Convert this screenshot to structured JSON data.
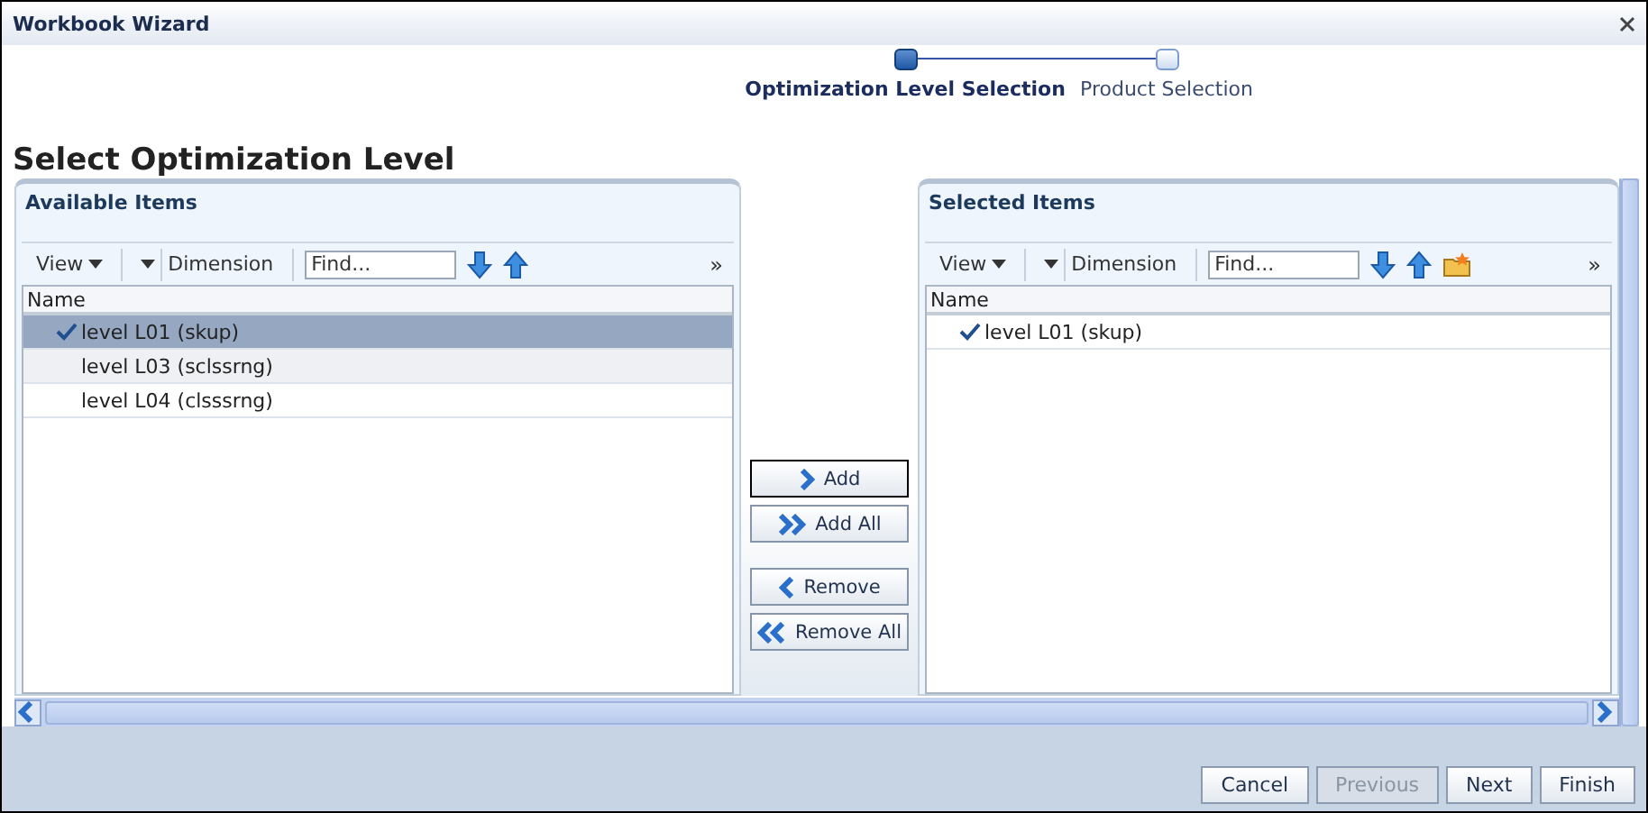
{
  "window": {
    "title": "Workbook Wizard"
  },
  "train": [
    {
      "label": "Optimization Level Selection",
      "selected": true
    },
    {
      "label": "Product Selection",
      "selected": false
    }
  ],
  "heading": "Select Optimization Level",
  "panels": [
    {
      "kind": "available",
      "title": "Available Items",
      "toolbar": {
        "view": "View",
        "dimension": "Dimension",
        "find_placeholder": "Find...",
        "overflow": "»"
      },
      "column": "Name",
      "rows": [
        {
          "label": "level L01 (skup)",
          "checked": true,
          "selected": true
        },
        {
          "label": "level L03 (sclssrng)",
          "checked": false,
          "selected": false
        },
        {
          "label": "level L04 (clsssrng)",
          "checked": false,
          "selected": false
        }
      ]
    },
    {
      "kind": "selected",
      "title": "Selected Items",
      "toolbar": {
        "view": "View",
        "dimension": "Dimension",
        "find_placeholder": "Find...",
        "overflow": "»"
      },
      "column": "Name",
      "rows": [
        {
          "label": "level L01 (skup)",
          "checked": true,
          "selected": false
        }
      ]
    }
  ],
  "shuttle": [
    {
      "kind": "add",
      "label": "Add",
      "focused": true
    },
    {
      "kind": "add_all",
      "label": "Add All",
      "focused": false
    },
    {
      "kind": "remove",
      "label": "Remove",
      "focused": false
    },
    {
      "kind": "remove_all",
      "label": "Remove All",
      "focused": false
    }
  ],
  "footer": [
    {
      "label": "Cancel",
      "disabled": false
    },
    {
      "label": "Previous",
      "disabled": true
    },
    {
      "label": "Next",
      "disabled": false
    },
    {
      "label": "Finish",
      "disabled": false
    }
  ]
}
